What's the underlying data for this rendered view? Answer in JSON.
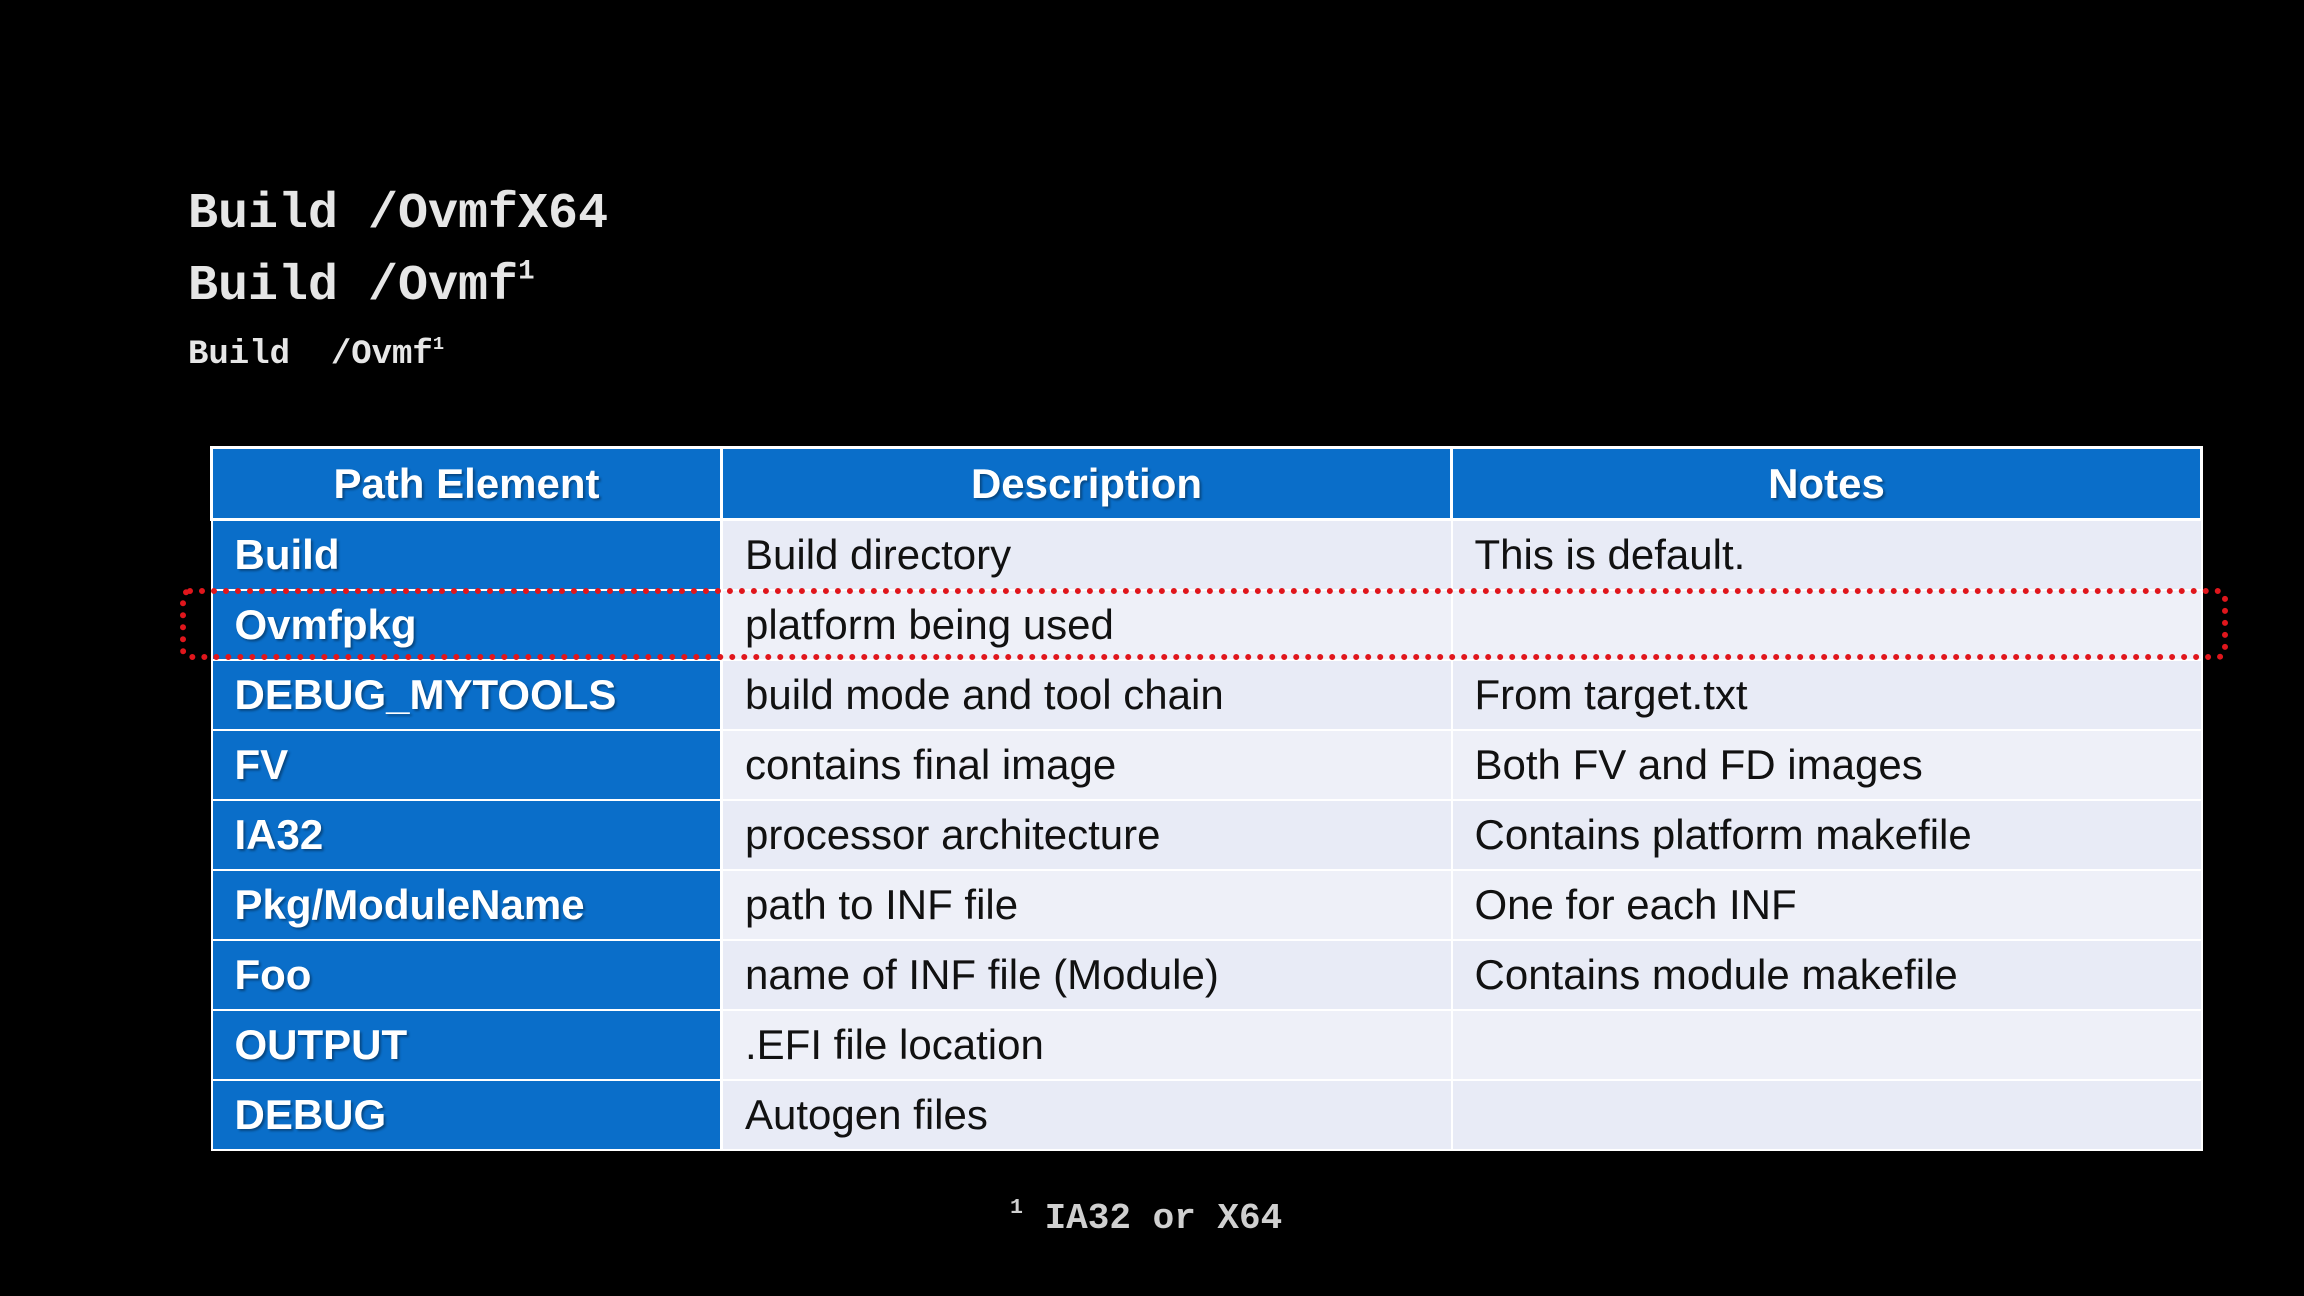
{
  "paths": {
    "line1_text": "Build /OvmfX64",
    "line2_text": "Build /Ovmf",
    "line2_sup": "1",
    "line3_text": "Build  /Ovmf",
    "line3_sup": "1"
  },
  "table": {
    "headers": [
      "Path Element",
      "Description",
      "Notes"
    ],
    "rows": [
      [
        "Build",
        "Build directory",
        "This is default."
      ],
      [
        "Ovmfpkg",
        "platform being used",
        ""
      ],
      [
        "DEBUG_MYTOOLS",
        "build mode and tool chain",
        "From target.txt"
      ],
      [
        "FV",
        "contains final image",
        "Both FV and FD images"
      ],
      [
        "IA32",
        "processor architecture",
        "Contains platform makefile"
      ],
      [
        "Pkg/ModuleName",
        "path to INF file",
        "One for each INF"
      ],
      [
        "Foo",
        "name of INF file (Module)",
        "Contains module makefile"
      ],
      [
        "OUTPUT",
        ".EFI file location",
        ""
      ],
      [
        "DEBUG",
        "Autogen files",
        ""
      ]
    ]
  },
  "footnote": {
    "sup": "1",
    "text": " IA32 or X64"
  },
  "colors": {
    "background": "#000000",
    "header_blue": "#0a6ec9",
    "cell_light": "#e8ebf6",
    "highlight_red": "#e0161c"
  }
}
